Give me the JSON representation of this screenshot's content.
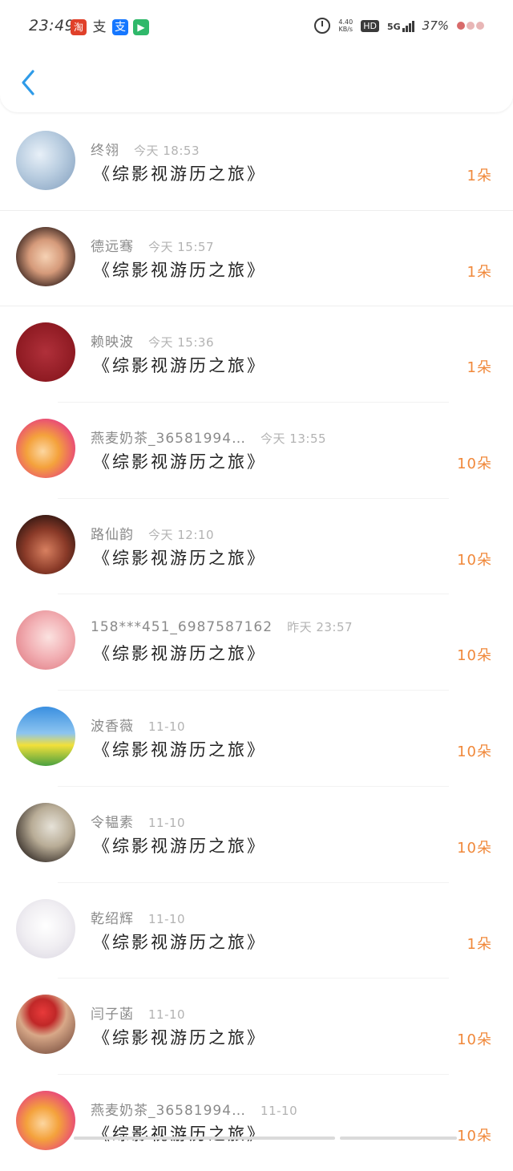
{
  "status_bar": {
    "time": "23:49",
    "net_speed_value": "4.40",
    "net_speed_unit": "KB/s",
    "hd_label": "HD",
    "network_label": "5G",
    "battery": "37%"
  },
  "colors": {
    "accent_blue": "#2f9be8",
    "count_orange": "#f0883a"
  },
  "list": [
    {
      "user": "终翎",
      "time": "今天 18:53",
      "book": "《综影视游历之旅》",
      "count": "1朵"
    },
    {
      "user": "德远骞",
      "time": "今天 15:57",
      "book": "《综影视游历之旅》",
      "count": "1朵"
    },
    {
      "user": "赖映波",
      "time": "今天 15:36",
      "book": "《综影视游历之旅》",
      "count": "1朵"
    },
    {
      "user": "燕麦奶茶_36581994…",
      "time": "今天 13:55",
      "book": "《综影视游历之旅》",
      "count": "10朵"
    },
    {
      "user": "路仙韵",
      "time": "今天 12:10",
      "book": "《综影视游历之旅》",
      "count": "10朵"
    },
    {
      "user": "158***451_6987587162",
      "time": "昨天 23:57",
      "book": "《综影视游历之旅》",
      "count": "10朵"
    },
    {
      "user": "波香薇",
      "time": "11-10",
      "book": "《综影视游历之旅》",
      "count": "10朵"
    },
    {
      "user": "令韫素",
      "time": "11-10",
      "book": "《综影视游历之旅》",
      "count": "10朵"
    },
    {
      "user": "乾绍辉",
      "time": "11-10",
      "book": "《综影视游历之旅》",
      "count": "1朵"
    },
    {
      "user": "闫子菡",
      "time": "11-10",
      "book": "《综影视游历之旅》",
      "count": "10朵"
    },
    {
      "user": "燕麦奶茶_36581994…",
      "time": "11-10",
      "book": "《综影视游历之旅》",
      "count": "10朵"
    }
  ]
}
